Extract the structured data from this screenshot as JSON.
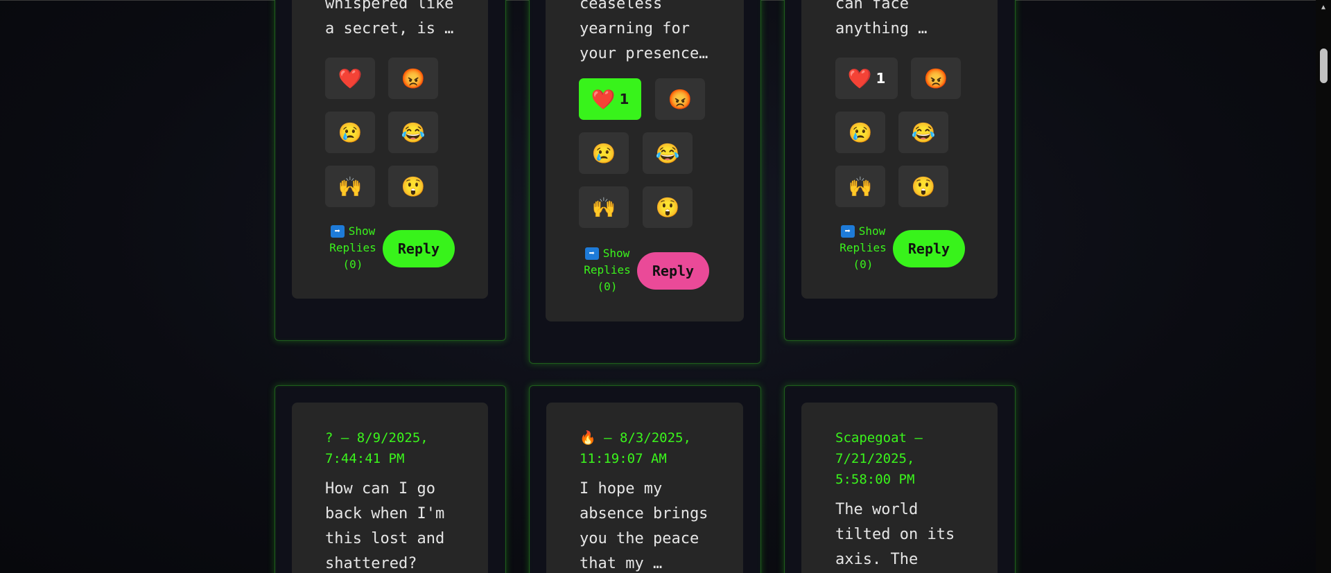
{
  "cards_top": [
    {
      "text": "whispered like\na secret, is …",
      "reactions": [
        {
          "icon": "heart-icon",
          "glyph": "❤️",
          "count": ""
        },
        {
          "icon": "angry-face-icon",
          "glyph": "😡",
          "count": ""
        },
        {
          "icon": "sad-face-icon",
          "glyph": "😢",
          "count": ""
        },
        {
          "icon": "tears-of-joy-icon",
          "glyph": "😂",
          "count": ""
        },
        {
          "icon": "raised-hands-icon",
          "glyph": "🙌",
          "count": ""
        },
        {
          "icon": "astonished-face-icon",
          "glyph": "😲",
          "count": ""
        }
      ],
      "show_replies_icon": "➡",
      "show_replies": "Show\nReplies\n(0)",
      "reply": "Reply"
    },
    {
      "text": "ceaseless\nyearning for\nyour presence…",
      "reactions": [
        {
          "icon": "heart-icon",
          "glyph": "❤️",
          "count": "1"
        },
        {
          "icon": "angry-face-icon",
          "glyph": "😡",
          "count": ""
        },
        {
          "icon": "sad-face-icon",
          "glyph": "😢",
          "count": ""
        },
        {
          "icon": "tears-of-joy-icon",
          "glyph": "😂",
          "count": ""
        },
        {
          "icon": "raised-hands-icon",
          "glyph": "🙌",
          "count": ""
        },
        {
          "icon": "astonished-face-icon",
          "glyph": "😲",
          "count": ""
        }
      ],
      "show_replies_icon": "➡",
      "show_replies": "Show\nReplies\n(0)",
      "reply": "Reply"
    },
    {
      "text": "can face\nanything …",
      "reactions": [
        {
          "icon": "heart-icon",
          "glyph": "❤️",
          "count": "1"
        },
        {
          "icon": "angry-face-icon",
          "glyph": "😡",
          "count": ""
        },
        {
          "icon": "sad-face-icon",
          "glyph": "😢",
          "count": ""
        },
        {
          "icon": "tears-of-joy-icon",
          "glyph": "😂",
          "count": ""
        },
        {
          "icon": "raised-hands-icon",
          "glyph": "🙌",
          "count": ""
        },
        {
          "icon": "astonished-face-icon",
          "glyph": "😲",
          "count": ""
        }
      ],
      "show_replies_icon": "➡",
      "show_replies": "Show\nReplies\n(0)",
      "reply": "Reply"
    }
  ],
  "cards_bottom": [
    {
      "meta": "? – 8/9/2025,\n7:44:41 PM",
      "text": "How can I go\nback when I'm\nthis lost and\nshattered?"
    },
    {
      "meta_icon": "🔥",
      "meta": " – 8/3/2025,\n11:19:07 AM",
      "text": "I hope my\nabsence brings\nyou the peace\nthat my …"
    },
    {
      "meta": "Scapegoat –\n7/21/2025,\n5:58:00 PM",
      "text": "The world\ntilted on its\naxis.  The"
    }
  ],
  "colors": {
    "accent_green": "#38f31b",
    "reply_pink": "#ea4a98",
    "card_bg": "#262626",
    "button_bg": "#333333"
  }
}
